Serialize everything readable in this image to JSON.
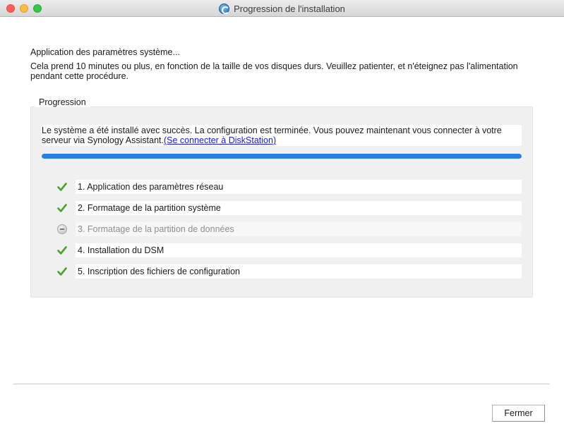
{
  "window": {
    "title": "Progression de l'installation"
  },
  "status": {
    "title": "Application des paramètres système...",
    "description": "Cela prend 10 minutes ou plus, en fonction de la taille de vos disques durs. Veuillez patienter, et n'éteignez pas l'alimentation pendant cette procédure."
  },
  "progress": {
    "group_label": "Progression",
    "message": "Le système a été installé avec succès. La configuration est terminée. Vous pouvez maintenant vous connecter à votre serveur via Synology Assistant.",
    "link_text": "(Se connecter à DiskStation)",
    "percent": 100,
    "bar_color": "#2a80e0"
  },
  "steps": [
    {
      "label": "1. Application des paramètres réseau",
      "state": "done",
      "icon": "check-icon"
    },
    {
      "label": "2. Formatage de la partition système",
      "state": "done",
      "icon": "check-icon"
    },
    {
      "label": "3. Formatage de la partition de données",
      "state": "skipped",
      "icon": "skip-icon"
    },
    {
      "label": "4. Installation du DSM",
      "state": "done",
      "icon": "check-icon"
    },
    {
      "label": "5. Inscription des fichiers de configuration",
      "state": "done",
      "icon": "check-icon"
    }
  ],
  "footer": {
    "close_label": "Fermer"
  }
}
